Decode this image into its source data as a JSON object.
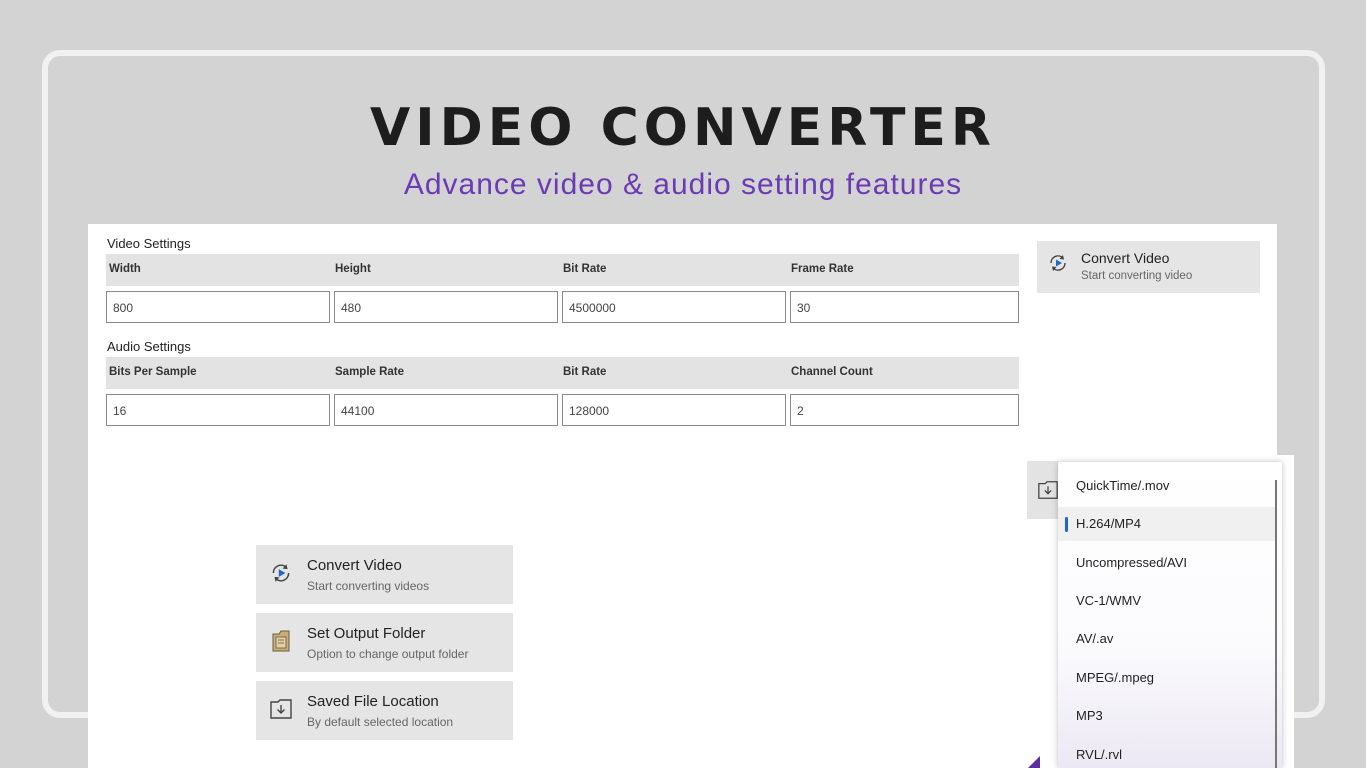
{
  "header": {
    "title": "VIDEO CONVERTER",
    "subtitle": "Advance video & audio setting features"
  },
  "video_settings": {
    "section_label": "Video Settings",
    "columns": [
      "Width",
      "Height",
      "Bit Rate",
      "Frame Rate"
    ],
    "values": [
      "800",
      "480",
      "4500000",
      "30"
    ]
  },
  "audio_settings": {
    "section_label": "Audio Settings",
    "columns": [
      "Bits Per Sample",
      "Sample Rate",
      "Bit Rate",
      "Channel Count"
    ],
    "values": [
      "16",
      "44100",
      "128000",
      "2"
    ]
  },
  "panel_convert": {
    "title": "Convert Video",
    "subtitle": "Start converting video"
  },
  "actions": [
    {
      "title": "Convert Video",
      "subtitle": "Start converting videos",
      "icon": "convert-icon"
    },
    {
      "title": "Set Output Folder",
      "subtitle": "Option to change output folder",
      "icon": "folder-icon"
    },
    {
      "title": "Saved File Location",
      "subtitle": "By default selected location",
      "icon": "download-folder-icon"
    }
  ],
  "format_dropdown": {
    "items": [
      "QuickTime/.mov",
      "H.264/MP4",
      "Uncompressed/AVI",
      "VC-1/WMV",
      "AV/.av",
      "MPEG/.mpeg",
      "MP3",
      "RVL/.rvl"
    ],
    "selected": "H.264/MP4"
  },
  "colors": {
    "accent_purple": "#6a3bb5",
    "selection_blue": "#1e66d0",
    "background": "#d3d3d3"
  }
}
